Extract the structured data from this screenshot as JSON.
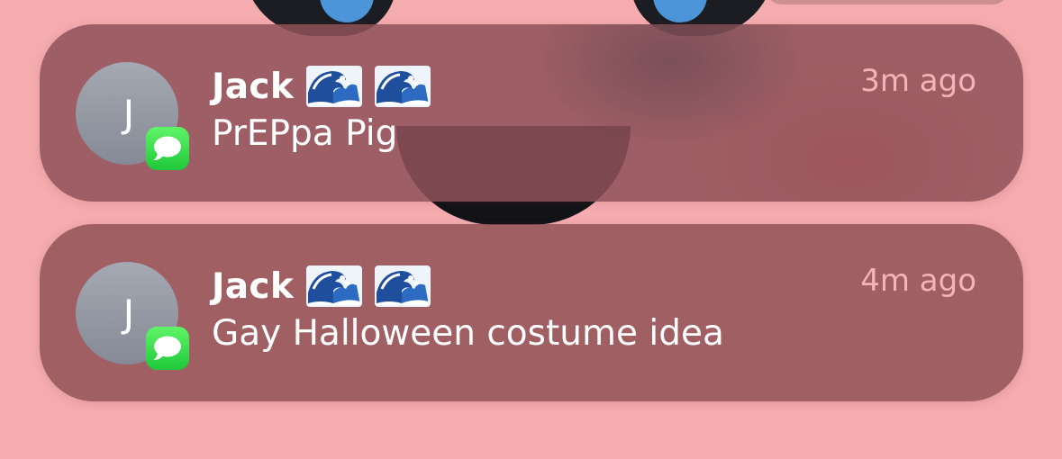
{
  "notifications": [
    {
      "avatar_letter": "J",
      "app_icon": "messages-app-icon",
      "sender": "Jack",
      "sender_emoji": [
        "wave-emoji",
        "wave-emoji"
      ],
      "body": "PrEPpa Pig",
      "time": "3m ago"
    },
    {
      "avatar_letter": "J",
      "app_icon": "messages-app-icon",
      "sender": "Jack",
      "sender_emoji": [
        "wave-emoji",
        "wave-emoji"
      ],
      "body": "Gay Halloween costume idea",
      "time": "4m ago"
    }
  ],
  "colors": {
    "background": "#f5acaf",
    "card": "#8c4e52",
    "messages_green": "#34d34b",
    "time_text": "#f4b3b6"
  }
}
